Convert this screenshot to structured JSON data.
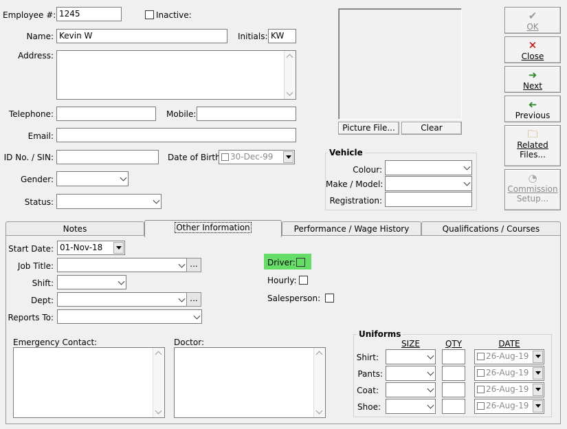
{
  "employee": {
    "number_label": "Employee #:",
    "number_value": "1245",
    "inactive_label": "Inactive:",
    "name_label": "Name:",
    "name_value": "Kevin W",
    "initials_label": "Initials:",
    "initials_value": "KW",
    "address_label": "Address:",
    "address_value": "",
    "telephone_label": "Telephone:",
    "telephone_value": "",
    "mobile_label": "Mobile:",
    "mobile_value": "",
    "email_label": "Email:",
    "email_value": "",
    "idno_label": "ID No. / SIN:",
    "idno_value": "",
    "dob_label": "Date of Birth:",
    "dob_value": "30-Dec-99",
    "gender_label": "Gender:",
    "gender_value": "",
    "status_label": "Status:",
    "status_value": ""
  },
  "picture": {
    "file_button": "Picture File...",
    "clear_button": "Clear"
  },
  "vehicle": {
    "title": "Vehicle",
    "colour_label": "Colour:",
    "colour_value": "",
    "make_label": "Make / Model:",
    "make_value": "",
    "registration_label": "Registration:",
    "registration_value": ""
  },
  "side_buttons": {
    "ok": "OK",
    "close": "Close",
    "next": "Next",
    "previous": "Previous",
    "related_1": "Related",
    "related_2": "Files...",
    "commission_1": "Commission",
    "commission_2": "Setup..."
  },
  "tabs": [
    {
      "label": "Notes"
    },
    {
      "label": "Other Information"
    },
    {
      "label": "Performance / Wage History"
    },
    {
      "label": "Qualifications / Courses"
    }
  ],
  "other": {
    "start_date_label": "Start Date:",
    "start_date_value": "01-Nov-18",
    "job_title_label": "Job Title:",
    "shift_label": "Shift:",
    "dept_label": "Dept:",
    "reports_to_label": "Reports To:",
    "driver_label": "Driver:",
    "hourly_label": "Hourly:",
    "salesperson_label": "Salesperson:",
    "emergency_label": "Emergency Contact:",
    "doctor_label": "Doctor:",
    "ellipsis": "..."
  },
  "uniforms": {
    "title": "Uniforms",
    "col_size": "SIZE",
    "col_qty": "QTY",
    "col_date": "DATE",
    "rows": [
      {
        "label": "Shirt:",
        "date": "26-Aug-19"
      },
      {
        "label": "Pants:",
        "date": "26-Aug-19"
      },
      {
        "label": "Coat:",
        "date": "26-Aug-19"
      },
      {
        "label": "Shoe:",
        "date": "26-Aug-19"
      }
    ]
  },
  "colors": {
    "driver_highlight": "#66dd66",
    "close_icon": "#cc0000",
    "nav_icon": "#2a8a2a"
  }
}
